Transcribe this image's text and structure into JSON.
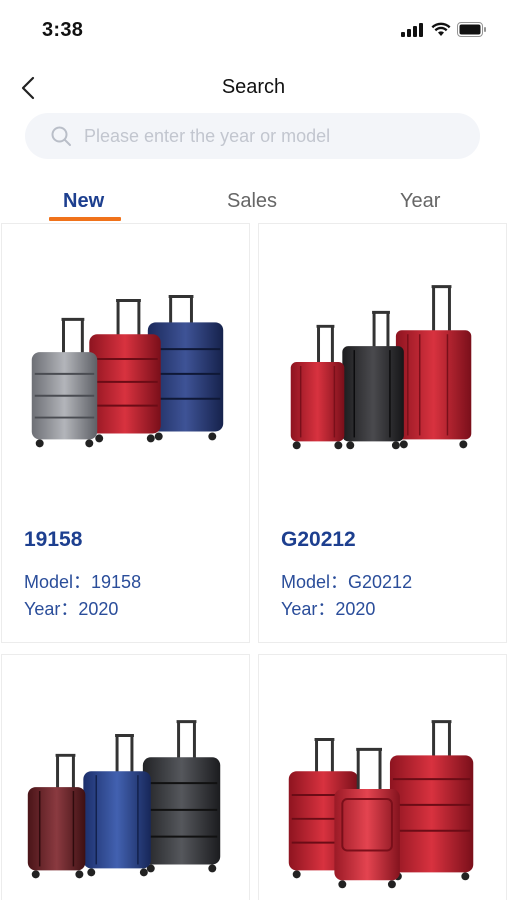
{
  "status_bar": {
    "time": "3:38"
  },
  "header": {
    "title": "Search"
  },
  "search": {
    "placeholder": "Please enter the year or model",
    "value": ""
  },
  "tabs": [
    {
      "label": "New",
      "active": true
    },
    {
      "label": "Sales",
      "active": false
    },
    {
      "label": "Year",
      "active": false
    }
  ],
  "colors": {
    "brand": "#1d3f8f",
    "accent": "#f0721b",
    "search_bg": "#f3f5f9"
  },
  "products": [
    {
      "code": "19158",
      "model": "Model：19158",
      "year": "Year：2020",
      "image": "luggage-set-silver-red-navy"
    },
    {
      "code": "G20212",
      "model": "Model：G20212",
      "year": "Year：2020",
      "image": "luggage-set-red-black-red"
    },
    {
      "code": "",
      "model": "",
      "year": "",
      "image": "luggage-set-burgundy-blue-black"
    },
    {
      "code": "",
      "model": "",
      "year": "",
      "image": "luggage-set-red-frontpocket"
    }
  ]
}
